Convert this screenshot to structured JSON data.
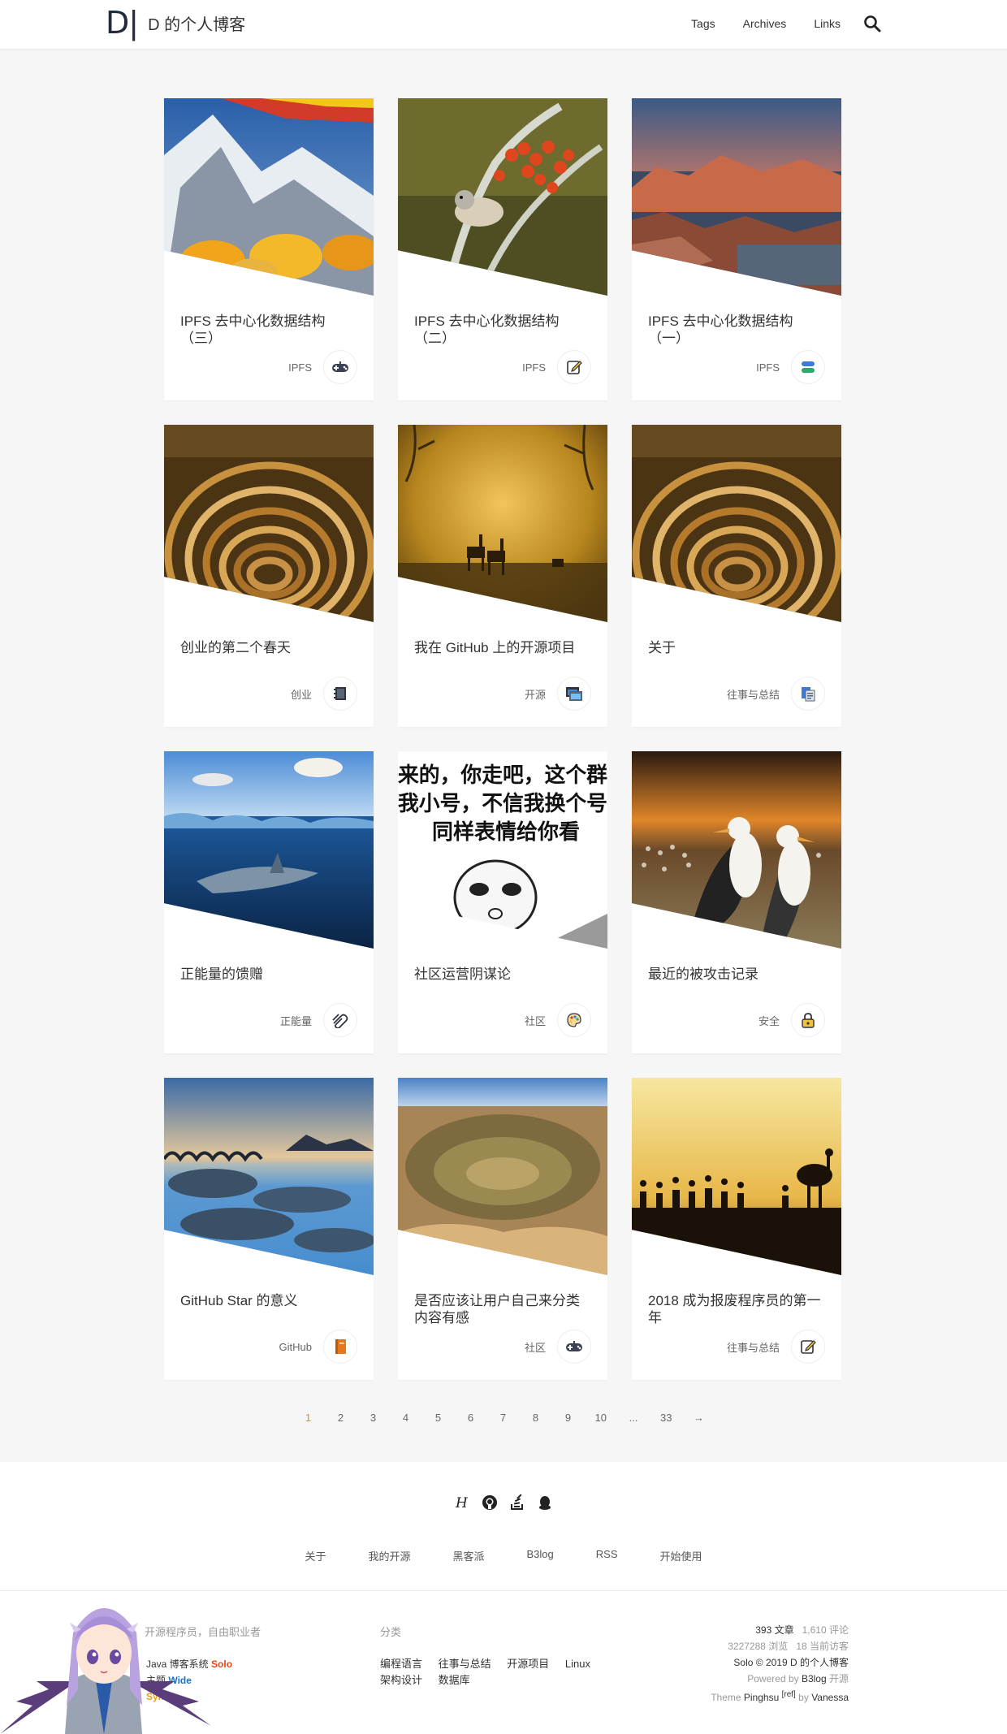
{
  "header": {
    "logo_mark": "D|",
    "title": "D 的个人博客",
    "nav": [
      "Tags",
      "Archives",
      "Links"
    ]
  },
  "articles": [
    {
      "title": "IPFS 去中心化数据结构（三）",
      "tag": "IPFS",
      "icon": "gamepad-icon"
    },
    {
      "title": "IPFS 去中心化数据结构（二）",
      "tag": "IPFS",
      "icon": "edit-icon"
    },
    {
      "title": "IPFS 去中心化数据结构（一）",
      "tag": "IPFS",
      "icon": "database-icon"
    },
    {
      "title": "创业的第二个春天",
      "tag": "创业",
      "icon": "notebook-icon"
    },
    {
      "title": "我在 GitHub 上的开源项目",
      "tag": "开源",
      "icon": "window-icon"
    },
    {
      "title": "关于",
      "tag": "往事与总结",
      "icon": "documents-icon"
    },
    {
      "title": "正能量的馈赠",
      "tag": "正能量",
      "icon": "paperclip-icon"
    },
    {
      "title": "社区运营阴谋论",
      "tag": "社区",
      "icon": "palette-icon"
    },
    {
      "title": "最近的被攻击记录",
      "tag": "安全",
      "icon": "lock-icon"
    },
    {
      "title": "GitHub Star 的意义",
      "tag": "GitHub",
      "icon": "book-icon"
    },
    {
      "title": "是否应该让用户自己来分类内容有感",
      "tag": "社区",
      "icon": "gamepad-icon"
    },
    {
      "title": "2018 成为报废程序员的第一年",
      "tag": "往事与总结",
      "icon": "edit-icon"
    }
  ],
  "meme_text": [
    "来的，你走吧，这个群",
    "我小号，不信我换个号",
    "同样表情给你看"
  ],
  "pagination": [
    "1",
    "2",
    "3",
    "4",
    "5",
    "6",
    "7",
    "8",
    "9",
    "10",
    "...",
    "33",
    "→"
  ],
  "footer": {
    "social_icons": [
      "hacpai-icon",
      "github-icon",
      "stackoverflow-icon",
      "qq-icon"
    ],
    "links": [
      "关于",
      "我的开源",
      "黑客派",
      "B3log",
      "RSS",
      "开始使用"
    ],
    "desc": "开源程序员，自由职业者",
    "system_line1_prefix": "Java 博客系统 ",
    "system_brand": "Solo",
    "system_line2_prefix": "主题 ",
    "system_wide": "Wide",
    "system_sync": "Sym",
    "categories_title": "分类",
    "categories": [
      "编程语言",
      "往事与总结",
      "开源项目",
      "Linux",
      "架构设计",
      "数据库"
    ],
    "stats_articles": "393 文章",
    "stats_comments": "1,610 评论",
    "stats_views": "3227288 浏览",
    "stats_online": "18 当前访客",
    "copyright_solo": "Solo",
    "copyright_rest": "© 2019 D 的个人博客",
    "powered_prefix": "Powered by ",
    "powered_b3log": "B3log",
    "powered_suffix": " 开源",
    "theme_prefix": "Theme ",
    "theme_name": "Pinghsu",
    "theme_ref": "[ref]",
    "theme_by": " by ",
    "theme_author": "Vanessa"
  }
}
